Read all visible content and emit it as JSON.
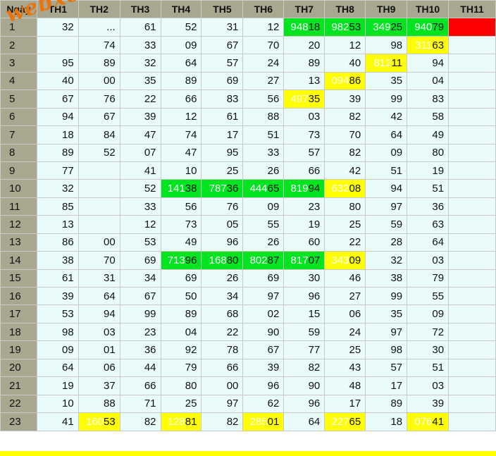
{
  "headers": [
    "Ngày",
    "TH1",
    "TH2",
    "TH3",
    "TH4",
    "TH5",
    "TH6",
    "TH7",
    "TH8",
    "TH9",
    "TH10",
    "TH11"
  ],
  "watermark": "webxoso.net",
  "colors": {
    "green": "#00e51f",
    "yellow": "#ffff00",
    "red": "#ff0000",
    "cell": "#e9fbfb",
    "header": "#a8a890"
  },
  "rows": [
    {
      "day": "1",
      "cells": [
        {
          "v": "32"
        },
        {
          "v": "..."
        },
        {
          "v": "61"
        },
        {
          "v": "52"
        },
        {
          "v": "31"
        },
        {
          "v": "12"
        },
        {
          "v": "18",
          "p": "948",
          "h": "green"
        },
        {
          "v": "53",
          "p": "982",
          "h": "green"
        },
        {
          "v": "25",
          "p": "349",
          "h": "green"
        },
        {
          "v": "79",
          "p": "940",
          "h": "green"
        },
        {
          "v": "",
          "h": "red"
        }
      ]
    },
    {
      "day": "2",
      "cells": [
        {
          "v": ""
        },
        {
          "v": "74"
        },
        {
          "v": "33"
        },
        {
          "v": "09"
        },
        {
          "v": "67"
        },
        {
          "v": "70"
        },
        {
          "v": "20"
        },
        {
          "v": "12"
        },
        {
          "v": "98"
        },
        {
          "v": "63",
          "p": "311",
          "h": "yellow"
        },
        {
          "v": ""
        }
      ]
    },
    {
      "day": "3",
      "cells": [
        {
          "v": "95"
        },
        {
          "v": "89"
        },
        {
          "v": "32"
        },
        {
          "v": "64"
        },
        {
          "v": "57"
        },
        {
          "v": "24"
        },
        {
          "v": "89"
        },
        {
          "v": "40"
        },
        {
          "v": "11",
          "p": "812",
          "h": "yellow"
        },
        {
          "v": "94"
        },
        {
          "v": ""
        }
      ]
    },
    {
      "day": "4",
      "cells": [
        {
          "v": "40"
        },
        {
          "v": "00"
        },
        {
          "v": "35"
        },
        {
          "v": "89"
        },
        {
          "v": "69"
        },
        {
          "v": "27"
        },
        {
          "v": "13"
        },
        {
          "v": "86",
          "p": "094",
          "h": "yellow"
        },
        {
          "v": "35"
        },
        {
          "v": "04"
        },
        {
          "v": ""
        }
      ]
    },
    {
      "day": "5",
      "cells": [
        {
          "v": "67"
        },
        {
          "v": "76"
        },
        {
          "v": "22"
        },
        {
          "v": "66"
        },
        {
          "v": "83"
        },
        {
          "v": "56"
        },
        {
          "v": "35",
          "p": "497",
          "h": "yellow"
        },
        {
          "v": "39"
        },
        {
          "v": "99"
        },
        {
          "v": "83"
        },
        {
          "v": ""
        }
      ]
    },
    {
      "day": "6",
      "cells": [
        {
          "v": "94"
        },
        {
          "v": "67"
        },
        {
          "v": "39"
        },
        {
          "v": "12"
        },
        {
          "v": "61"
        },
        {
          "v": "88"
        },
        {
          "v": "03"
        },
        {
          "v": "82"
        },
        {
          "v": "42"
        },
        {
          "v": "58"
        },
        {
          "v": ""
        }
      ]
    },
    {
      "day": "7",
      "cells": [
        {
          "v": "18"
        },
        {
          "v": "84"
        },
        {
          "v": "47"
        },
        {
          "v": "74"
        },
        {
          "v": "17"
        },
        {
          "v": "51"
        },
        {
          "v": "73"
        },
        {
          "v": "70"
        },
        {
          "v": "64"
        },
        {
          "v": "49"
        },
        {
          "v": ""
        }
      ]
    },
    {
      "day": "8",
      "cells": [
        {
          "v": "89"
        },
        {
          "v": "52"
        },
        {
          "v": "07"
        },
        {
          "v": "47"
        },
        {
          "v": "95"
        },
        {
          "v": "33"
        },
        {
          "v": "57"
        },
        {
          "v": "82"
        },
        {
          "v": "09"
        },
        {
          "v": "80"
        },
        {
          "v": ""
        }
      ]
    },
    {
      "day": "9",
      "cells": [
        {
          "v": "77"
        },
        {
          "v": ""
        },
        {
          "v": "41"
        },
        {
          "v": "10"
        },
        {
          "v": "25"
        },
        {
          "v": "26"
        },
        {
          "v": "66"
        },
        {
          "v": "42"
        },
        {
          "v": "51"
        },
        {
          "v": "19"
        },
        {
          "v": ""
        }
      ]
    },
    {
      "day": "10",
      "cells": [
        {
          "v": "32"
        },
        {
          "v": ""
        },
        {
          "v": "52"
        },
        {
          "v": "38",
          "p": "141",
          "h": "green"
        },
        {
          "v": "36",
          "p": "787",
          "h": "green"
        },
        {
          "v": "65",
          "p": "444",
          "h": "green"
        },
        {
          "v": "94",
          "p": "819",
          "h": "green"
        },
        {
          "v": "08",
          "p": "632",
          "h": "yellow"
        },
        {
          "v": "94"
        },
        {
          "v": "51"
        },
        {
          "v": ""
        }
      ]
    },
    {
      "day": "11",
      "cells": [
        {
          "v": "85"
        },
        {
          "v": ""
        },
        {
          "v": "33"
        },
        {
          "v": "56"
        },
        {
          "v": "76"
        },
        {
          "v": "09"
        },
        {
          "v": "23"
        },
        {
          "v": "80"
        },
        {
          "v": "97"
        },
        {
          "v": "36"
        },
        {
          "v": ""
        }
      ]
    },
    {
      "day": "12",
      "cells": [
        {
          "v": "13"
        },
        {
          "v": ""
        },
        {
          "v": "12"
        },
        {
          "v": "73"
        },
        {
          "v": "05"
        },
        {
          "v": "55"
        },
        {
          "v": "19"
        },
        {
          "v": "25"
        },
        {
          "v": "59"
        },
        {
          "v": "63"
        },
        {
          "v": ""
        }
      ]
    },
    {
      "day": "13",
      "cells": [
        {
          "v": "86"
        },
        {
          "v": "00"
        },
        {
          "v": "53"
        },
        {
          "v": "49"
        },
        {
          "v": "96"
        },
        {
          "v": "26"
        },
        {
          "v": "60"
        },
        {
          "v": "22"
        },
        {
          "v": "28"
        },
        {
          "v": "64"
        },
        {
          "v": ""
        }
      ]
    },
    {
      "day": "14",
      "cells": [
        {
          "v": "38"
        },
        {
          "v": "70"
        },
        {
          "v": "69"
        },
        {
          "v": "96",
          "p": "713",
          "h": "green"
        },
        {
          "v": "80",
          "p": "168",
          "h": "green"
        },
        {
          "v": "87",
          "p": "802",
          "h": "green"
        },
        {
          "v": "07",
          "p": "817",
          "h": "green"
        },
        {
          "v": "09",
          "p": "343",
          "h": "yellow"
        },
        {
          "v": "32"
        },
        {
          "v": "03"
        },
        {
          "v": ""
        }
      ]
    },
    {
      "day": "15",
      "cells": [
        {
          "v": "61"
        },
        {
          "v": "31"
        },
        {
          "v": "34"
        },
        {
          "v": "69"
        },
        {
          "v": "26"
        },
        {
          "v": "69"
        },
        {
          "v": "30"
        },
        {
          "v": "46"
        },
        {
          "v": "38"
        },
        {
          "v": "79"
        },
        {
          "v": ""
        }
      ]
    },
    {
      "day": "16",
      "cells": [
        {
          "v": "39"
        },
        {
          "v": "64"
        },
        {
          "v": "67"
        },
        {
          "v": "50"
        },
        {
          "v": "34"
        },
        {
          "v": "97"
        },
        {
          "v": "96"
        },
        {
          "v": "27"
        },
        {
          "v": "99"
        },
        {
          "v": "55"
        },
        {
          "v": ""
        }
      ]
    },
    {
      "day": "17",
      "cells": [
        {
          "v": "53"
        },
        {
          "v": "94"
        },
        {
          "v": "99"
        },
        {
          "v": "89"
        },
        {
          "v": "68"
        },
        {
          "v": "02"
        },
        {
          "v": "15"
        },
        {
          "v": "06"
        },
        {
          "v": "35"
        },
        {
          "v": "09"
        },
        {
          "v": ""
        }
      ]
    },
    {
      "day": "18",
      "cells": [
        {
          "v": "98"
        },
        {
          "v": "03"
        },
        {
          "v": "23"
        },
        {
          "v": "04"
        },
        {
          "v": "22"
        },
        {
          "v": "90"
        },
        {
          "v": "59"
        },
        {
          "v": "24"
        },
        {
          "v": "97"
        },
        {
          "v": "72"
        },
        {
          "v": ""
        }
      ]
    },
    {
      "day": "19",
      "cells": [
        {
          "v": "09"
        },
        {
          "v": "01"
        },
        {
          "v": "36"
        },
        {
          "v": "92"
        },
        {
          "v": "78"
        },
        {
          "v": "67"
        },
        {
          "v": "77"
        },
        {
          "v": "25"
        },
        {
          "v": "98"
        },
        {
          "v": "30"
        },
        {
          "v": ""
        }
      ]
    },
    {
      "day": "20",
      "cells": [
        {
          "v": "64"
        },
        {
          "v": "06"
        },
        {
          "v": "44"
        },
        {
          "v": "79"
        },
        {
          "v": "66"
        },
        {
          "v": "39"
        },
        {
          "v": "82"
        },
        {
          "v": "43"
        },
        {
          "v": "57"
        },
        {
          "v": "51"
        },
        {
          "v": ""
        }
      ]
    },
    {
      "day": "21",
      "cells": [
        {
          "v": "19"
        },
        {
          "v": "37"
        },
        {
          "v": "66"
        },
        {
          "v": "80"
        },
        {
          "v": "00"
        },
        {
          "v": "96"
        },
        {
          "v": "90"
        },
        {
          "v": "48"
        },
        {
          "v": "17"
        },
        {
          "v": "03"
        },
        {
          "v": ""
        }
      ]
    },
    {
      "day": "22",
      "cells": [
        {
          "v": "10"
        },
        {
          "v": "88"
        },
        {
          "v": "71"
        },
        {
          "v": "25"
        },
        {
          "v": "97"
        },
        {
          "v": "62"
        },
        {
          "v": "96"
        },
        {
          "v": "17"
        },
        {
          "v": "89"
        },
        {
          "v": "39"
        },
        {
          "v": ""
        }
      ]
    },
    {
      "day": "23",
      "cells": [
        {
          "v": "41"
        },
        {
          "v": "53",
          "p": "160",
          "h": "yellow"
        },
        {
          "v": "82"
        },
        {
          "v": "81",
          "p": "128",
          "h": "yellow"
        },
        {
          "v": "82"
        },
        {
          "v": "01",
          "p": "285",
          "h": "yellow"
        },
        {
          "v": "64"
        },
        {
          "v": "65",
          "p": "227",
          "h": "yellow"
        },
        {
          "v": "18"
        },
        {
          "v": "41",
          "p": "076",
          "h": "yellow"
        },
        {
          "v": ""
        }
      ]
    }
  ]
}
